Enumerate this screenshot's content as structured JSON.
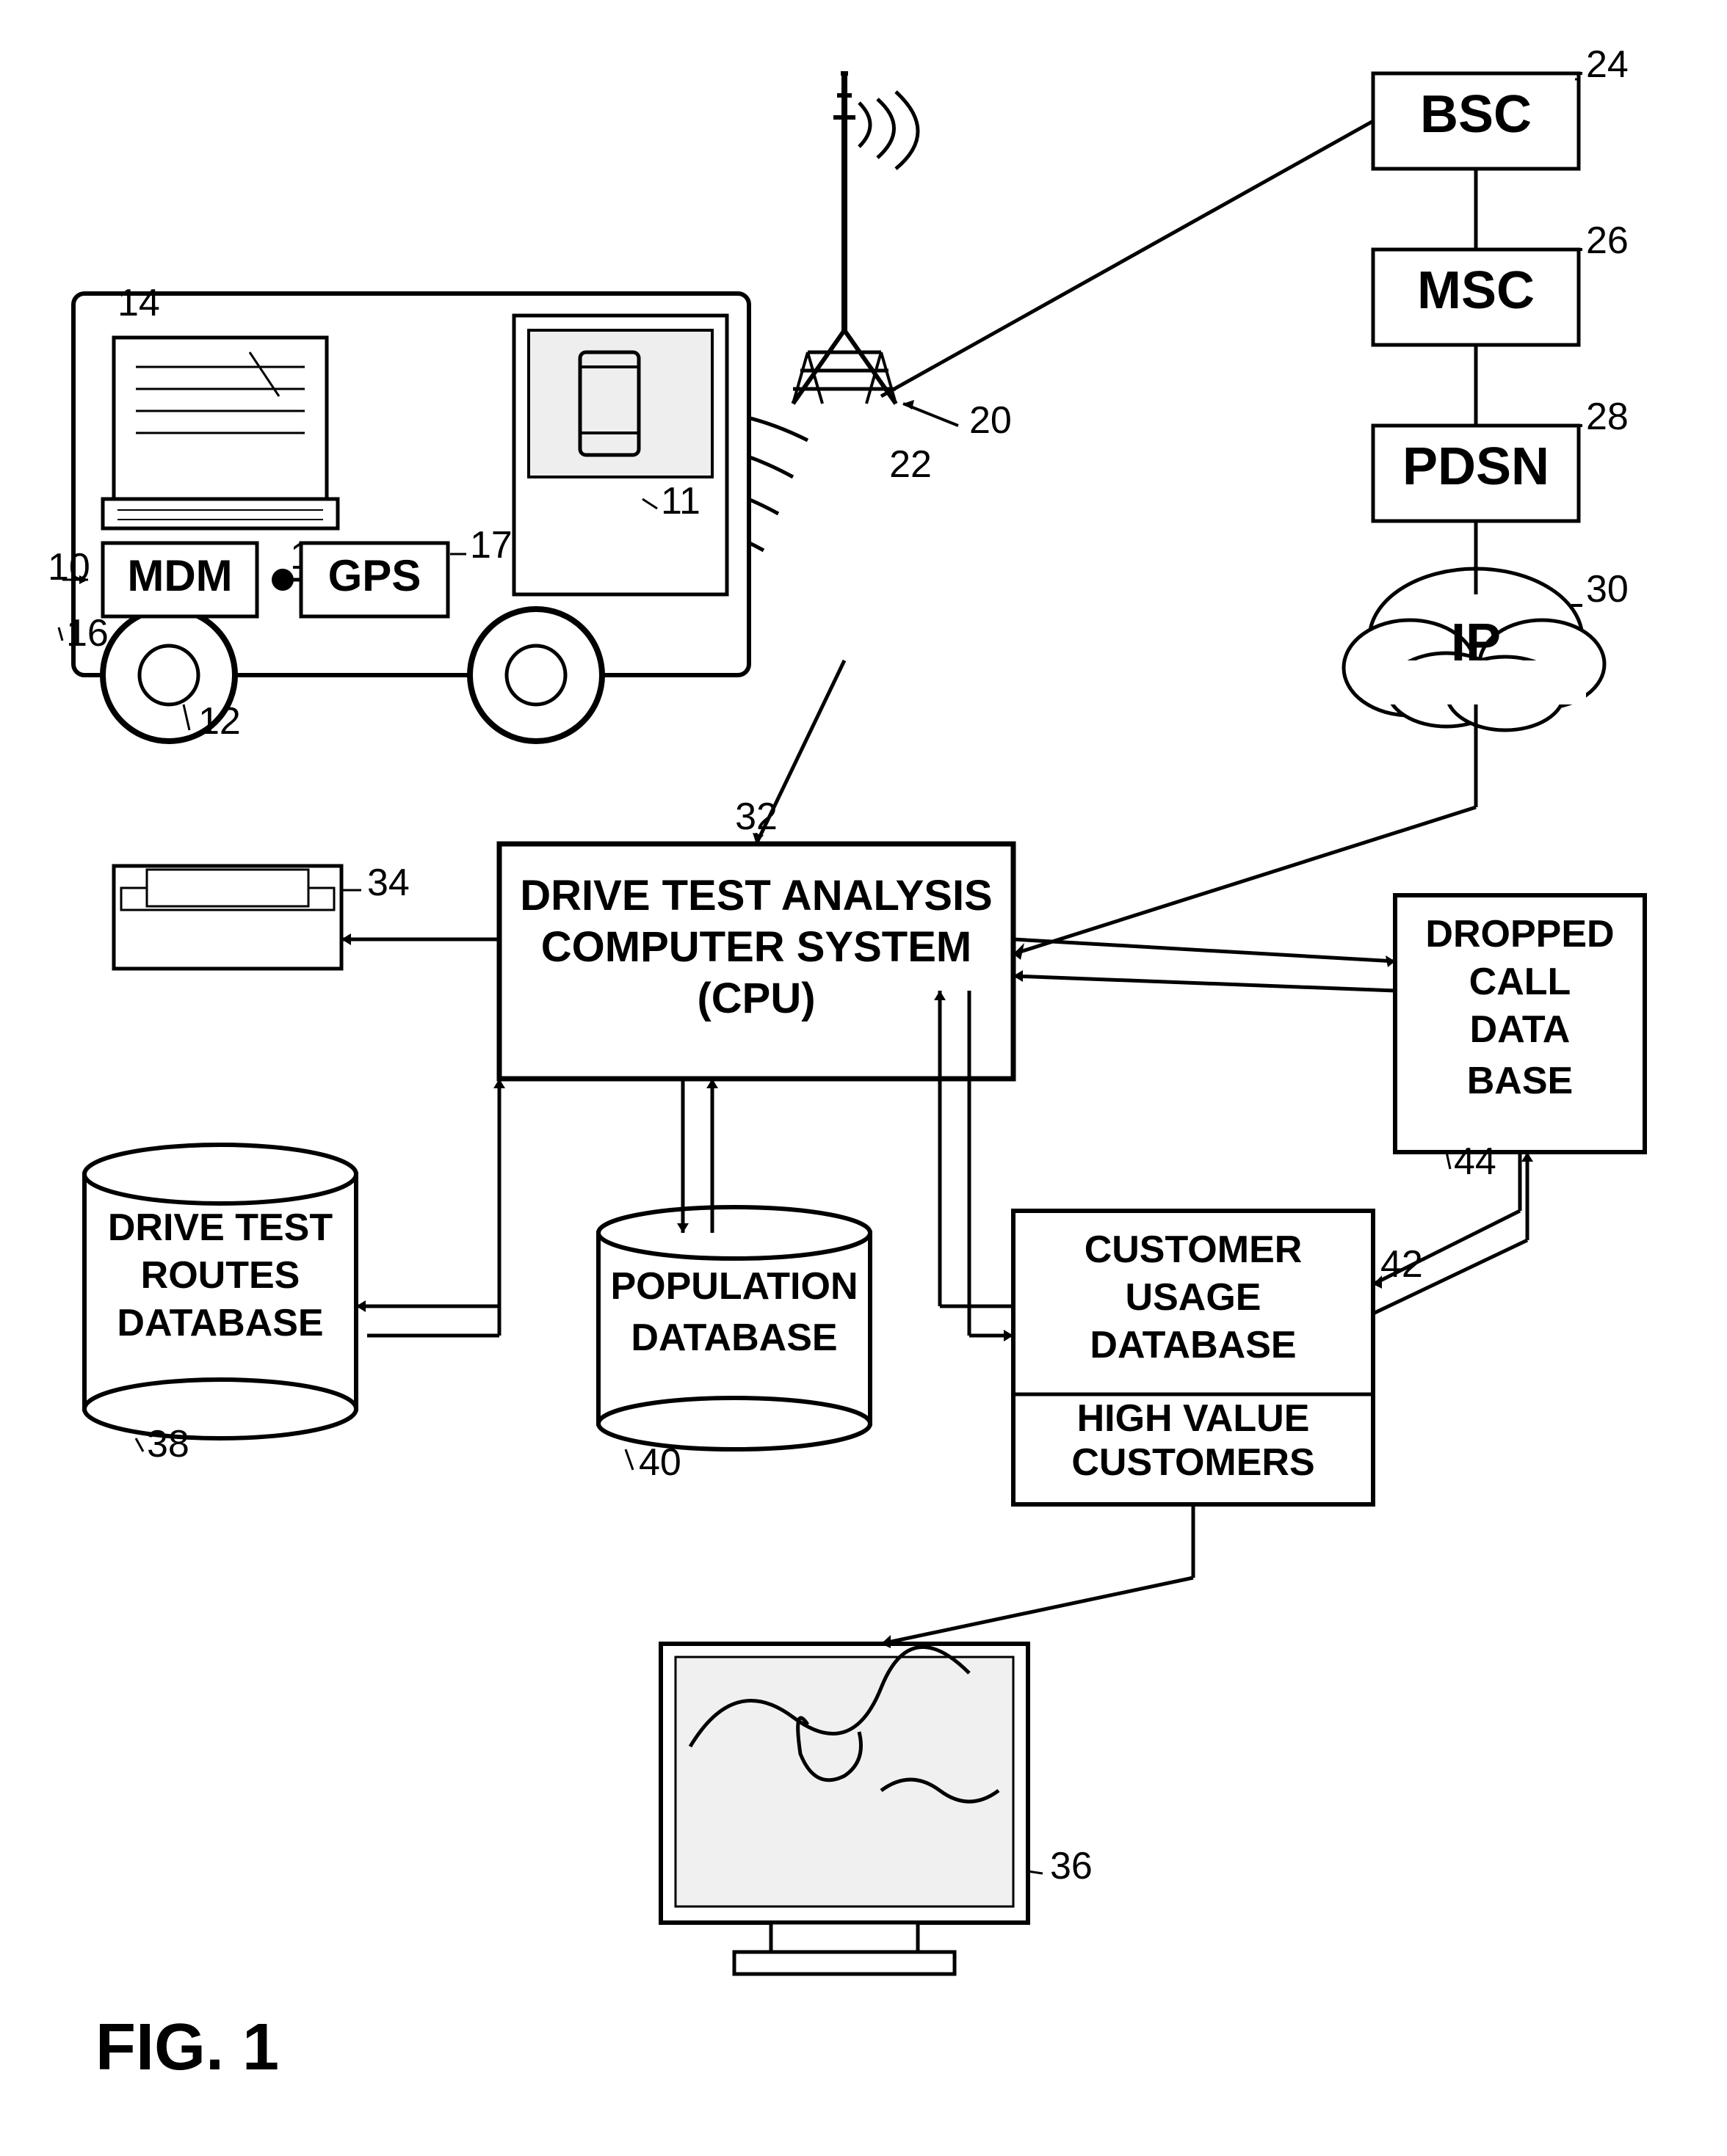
{
  "title": "FIG. 1 - Drive Test Analysis System Diagram",
  "fig_label": "FIG. 1",
  "components": {
    "bsc": {
      "label": "BSC",
      "number": "24"
    },
    "msc": {
      "label": "MSC",
      "number": "26"
    },
    "pdsn": {
      "label": "PDSN",
      "number": "28"
    },
    "ip": {
      "label": "IP",
      "number": "30"
    },
    "tower": {
      "number": "22"
    },
    "system_number": "20",
    "mdm": {
      "label": "MDM",
      "number": "16"
    },
    "gps": {
      "label": "GPS",
      "number": "17"
    },
    "laptop_number": "14",
    "phone_number": "11",
    "truck_number": "12",
    "mdm_dot": "18",
    "cpu": {
      "label": "DRIVE TEST ANALYSIS\nCOMPUTER SYSTEM\n(CPU)",
      "number": "32"
    },
    "printer": {
      "number": "34"
    },
    "drive_test_routes": {
      "label": "DRIVE TEST\nROUTES\nDATABASE",
      "number": "38"
    },
    "population_db": {
      "label": "POPULATION\nDATABASE",
      "number": "40"
    },
    "customer_usage_db": {
      "label": "CUSTOMER\nUSAGE\nDATABASE",
      "number": "42"
    },
    "high_value": {
      "label": "HIGH VALUE\nCUSTOMERS"
    },
    "dropped_call": {
      "label": "DROPPED\nCALL\nDATA\nBASE",
      "number": "44"
    },
    "monitor": {
      "number": "36"
    }
  }
}
